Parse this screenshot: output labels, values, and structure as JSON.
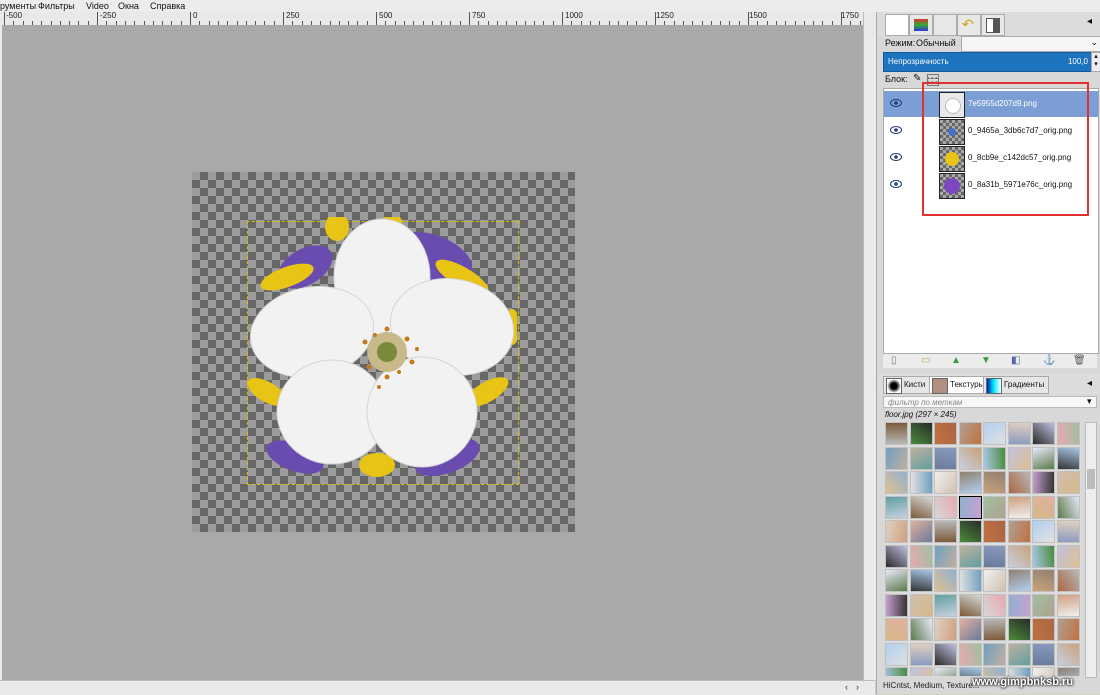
{
  "menu": [
    "рументы",
    "Фильтры",
    "Video",
    "Окна",
    "Справка"
  ],
  "ruler": {
    "labels": [
      "-500",
      "-250",
      "0",
      "250",
      "500",
      "750",
      "1000",
      "1250",
      "1500",
      "1750"
    ]
  },
  "layers_panel": {
    "mode_label": "Режим:",
    "mode_value": "Обычный",
    "opacity_label": "Непрозрачность",
    "opacity_value": "100,0",
    "lock_label": "Блок:",
    "layers": [
      {
        "name": "7e5955d207d9.png",
        "active": true,
        "visible": true
      },
      {
        "name": "0_9465a_3db6c7d7_orig.png",
        "active": false,
        "visible": true
      },
      {
        "name": "0_8cb9e_c142dc57_orig.png",
        "active": false,
        "visible": true
      },
      {
        "name": "0_8a31b_5971e76c_orig.png",
        "active": false,
        "visible": true
      }
    ]
  },
  "resource_tabs": {
    "brushes": "Кисти",
    "patterns": "Текстуры",
    "gradients": "Градиенты"
  },
  "tag_filter_placeholder": "фильтр по меткам",
  "pattern_info": "floor.jpg (297 × 245)",
  "tags": "HiCntst, Medium, Texture...",
  "watermark": "www.gimpbnksb.ru",
  "colors": {
    "accent": "#1e73be",
    "selection": "#7b9fd4",
    "highlight": "#e03030"
  }
}
